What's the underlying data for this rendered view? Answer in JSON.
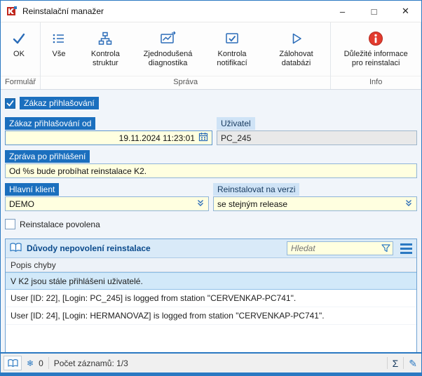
{
  "window": {
    "title": "Reinstalační manažer"
  },
  "titlebar": {
    "minimize": "–",
    "maximize": "□",
    "close": "✕"
  },
  "toolbar": {
    "groups": [
      {
        "label": "Formulář",
        "buttons": [
          {
            "label": "OK",
            "icon": "ok-check-icon"
          }
        ]
      },
      {
        "label": "Správa",
        "buttons": [
          {
            "label": "Vše",
            "icon": "list-icon"
          },
          {
            "label": "Kontrola struktur",
            "icon": "structure-icon"
          },
          {
            "label": "Zjednodušená diagnostika",
            "icon": "diagnostics-icon"
          },
          {
            "label": "Kontrola notifikací",
            "icon": "notification-check-icon"
          },
          {
            "label": "Zálohovat databázi",
            "icon": "backup-play-icon"
          }
        ]
      },
      {
        "label": "Info",
        "buttons": [
          {
            "label": "Důležité informace pro reinstalaci",
            "icon": "important-info-icon"
          }
        ]
      }
    ]
  },
  "form": {
    "ban_checkbox": {
      "label": "Zákaz přihlašování",
      "checked": true
    },
    "ban_from": {
      "label": "Zákaz přihlašování od",
      "value": "19.11.2024 11:23:01"
    },
    "user": {
      "label": "Uživatel",
      "value": "PC_245"
    },
    "message": {
      "label": "Zpráva po přihlášení",
      "value": "Od %s bude probíhat reinstalace K2."
    },
    "main_client": {
      "label": "Hlavní klient",
      "value": "DEMO"
    },
    "reinstall_version": {
      "label": "Reinstalovat na verzi",
      "value": "se stejným release"
    },
    "allowed_checkbox": {
      "label": "Reinstalace povolena",
      "checked": false
    }
  },
  "grid": {
    "title": "Důvody nepovolení reinstalace",
    "search_placeholder": "Hledat",
    "column_header": "Popis chyby",
    "rows": [
      {
        "text": "V K2 jsou stále přihlášeni uživatelé.",
        "selected": true
      },
      {
        "text": "User [ID: 22], [Login: PC_245] is logged from station \"CERVENKAP-PC741\".",
        "selected": false
      },
      {
        "text": "User [ID: 24], [Login: HERMANOVAZ] is logged from station \"CERVENKAP-PC741\".",
        "selected": false
      }
    ]
  },
  "statusbar": {
    "counter": "0",
    "records": "Počet záznamů: 1/3"
  },
  "icons": {
    "snowflake": "❄",
    "sigma": "Σ",
    "pencil": "✎"
  },
  "colors": {
    "accent_blue": "#2b79c2",
    "required_label_bg": "#1b6fbe",
    "input_yellow": "#ffffe0",
    "selected_row": "#d2e9f9",
    "info_red": "#e23b2e"
  }
}
